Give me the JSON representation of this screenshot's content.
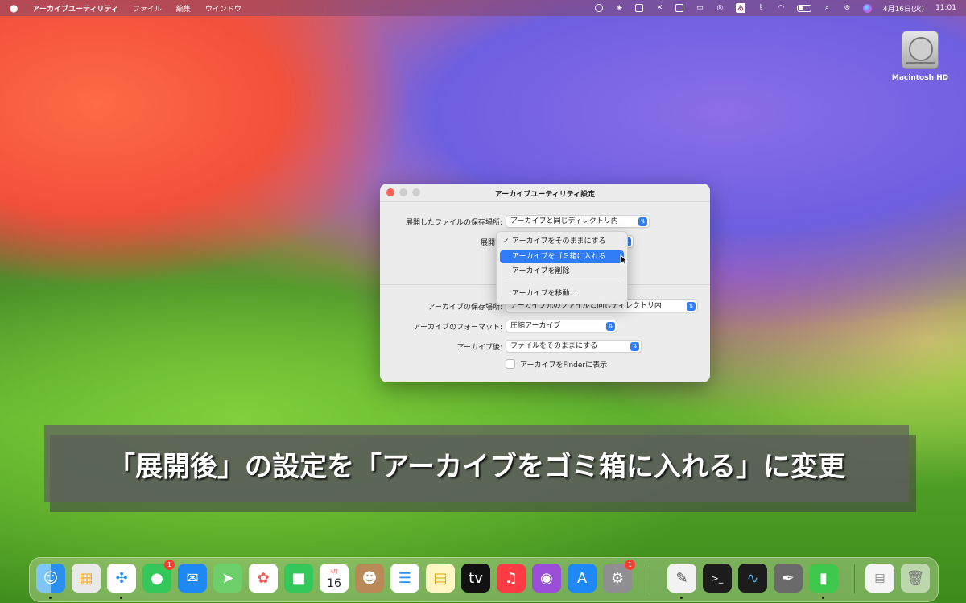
{
  "menubar": {
    "apple": "",
    "app_name": "アーカイブユーティリティ",
    "menus": [
      "ファイル",
      "編集",
      "ウインドウ"
    ],
    "ime": "あ",
    "date": "4月16日(火)",
    "time": "11:01"
  },
  "desktop": {
    "disk_label": "Macintosh HD"
  },
  "dialog": {
    "title": "アーカイブユーティリティ設定",
    "expand_location_label": "展開したファイルの保存場所:",
    "expand_location_value": "アーカイブと同じディレクトリ内",
    "after_expand_label": "展開後",
    "archive_location_label": "アーカイブの保存場所:",
    "archive_location_value": "アーカイブ元のファイルと同じディレクトリ内",
    "archive_format_label": "アーカイブのフォーマット:",
    "archive_format_value": "圧縮アーカイブ",
    "after_archive_label": "アーカイブ後:",
    "after_archive_value": "ファイルをそのままにする",
    "show_in_finder_label": "アーカイブをFinderに表示",
    "stepper_glyph": "⇅"
  },
  "dropdown": {
    "items": [
      {
        "label": "アーカイブをそのままにする",
        "checked": true
      },
      {
        "label": "アーカイブをゴミ箱に入れる",
        "highlighted": true
      },
      {
        "label": "アーカイブを削除"
      },
      {
        "label": "アーカイブを移動..."
      }
    ],
    "check": "✓"
  },
  "caption": {
    "text": "「展開後」の設定を「アーカイブをゴミ箱に入れる」に変更"
  },
  "dock": {
    "messages_badge": "1",
    "calendar_month": "4月",
    "calendar_day": "16",
    "settings_badge": "1"
  },
  "colors": {
    "accent": "#2f7cf6",
    "close": "#ff5f57",
    "badge": "#ff3b30"
  }
}
